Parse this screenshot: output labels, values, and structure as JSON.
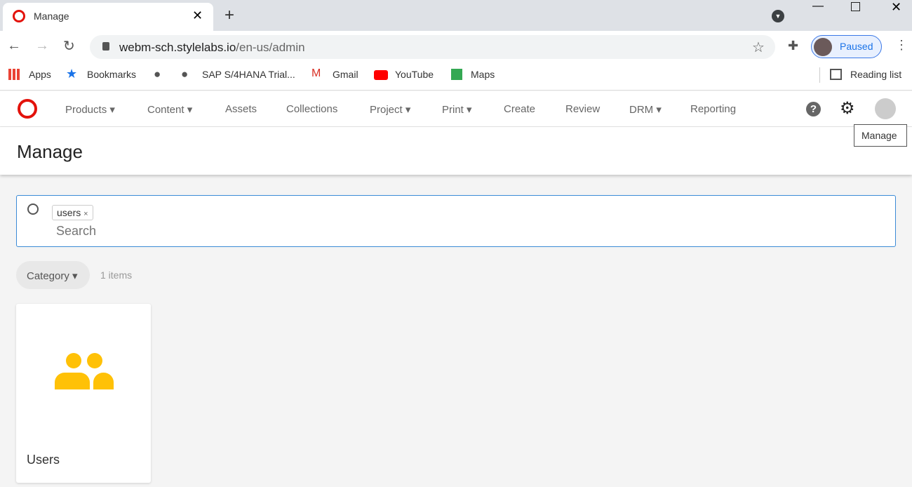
{
  "browser": {
    "tab_title": "Manage",
    "url_host": "webm-sch.stylelabs.io",
    "url_path": "/en-us/admin",
    "profile": "Paused",
    "bookmarks": [
      "Apps",
      "Bookmarks",
      "SAP S/4HANA Trial...",
      "Gmail",
      "YouTube",
      "Maps"
    ],
    "reading_list": "Reading list"
  },
  "nav": {
    "items": [
      "Products ▾",
      "Content ▾",
      "Assets",
      "Collections",
      "Project ▾",
      "Print ▾",
      "Create",
      "Review",
      "DRM ▾",
      "Reporting"
    ],
    "tooltip": "Manage"
  },
  "page": {
    "title": "Manage",
    "search_tag": "users",
    "search_placeholder": "Search",
    "category": "Category ▾",
    "count": "1 items",
    "card_label": "Users"
  },
  "colors": {
    "accent": "#3b8bd6",
    "icon": "#ffc107",
    "brand": "#e3120b"
  }
}
